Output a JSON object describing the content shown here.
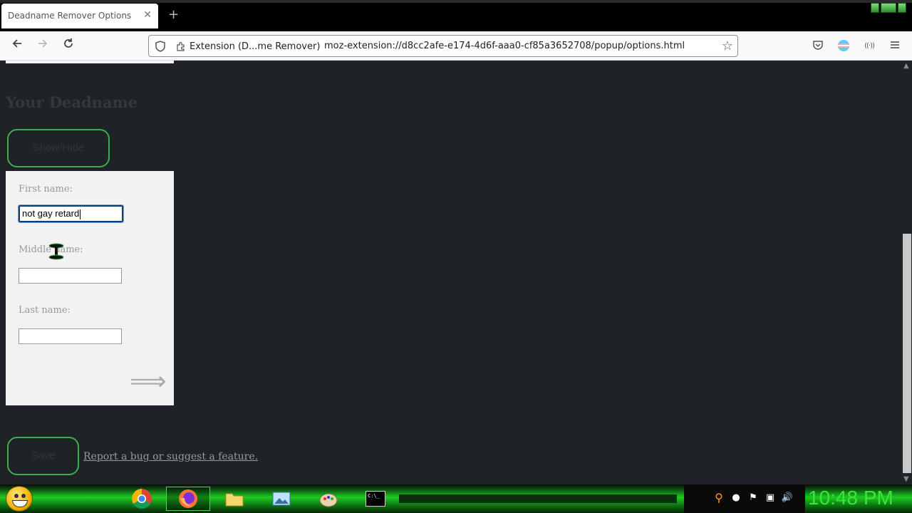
{
  "browser": {
    "tab_title": "Deadname Remover Options",
    "tab_close": "✕",
    "new_tab": "+",
    "identity_label": "Extension (D...me Remover)",
    "url": "moz-extension://d8cc2afe-e174-4d6f-aaa0-cf85a3652708/popup/options.html"
  },
  "page": {
    "heading": "Your Deadname",
    "show_hide_button": "Show/Hide",
    "form": {
      "first_name_label": "First name:",
      "first_name_value": "not gay retard",
      "middle_name_label": "Middle name:",
      "middle_name_value": "",
      "last_name_label": "Last name:",
      "last_name_value": "",
      "next_arrow": "⟹"
    },
    "save_button": "Save",
    "report_link": "Report a bug or suggest a feature."
  },
  "taskbar": {
    "clock": "10:48 PM",
    "cmd_label": "C:\\_"
  },
  "colors": {
    "page_bg": "#1f2328",
    "button_border": "#3fae4f",
    "clock": "#39e639"
  }
}
